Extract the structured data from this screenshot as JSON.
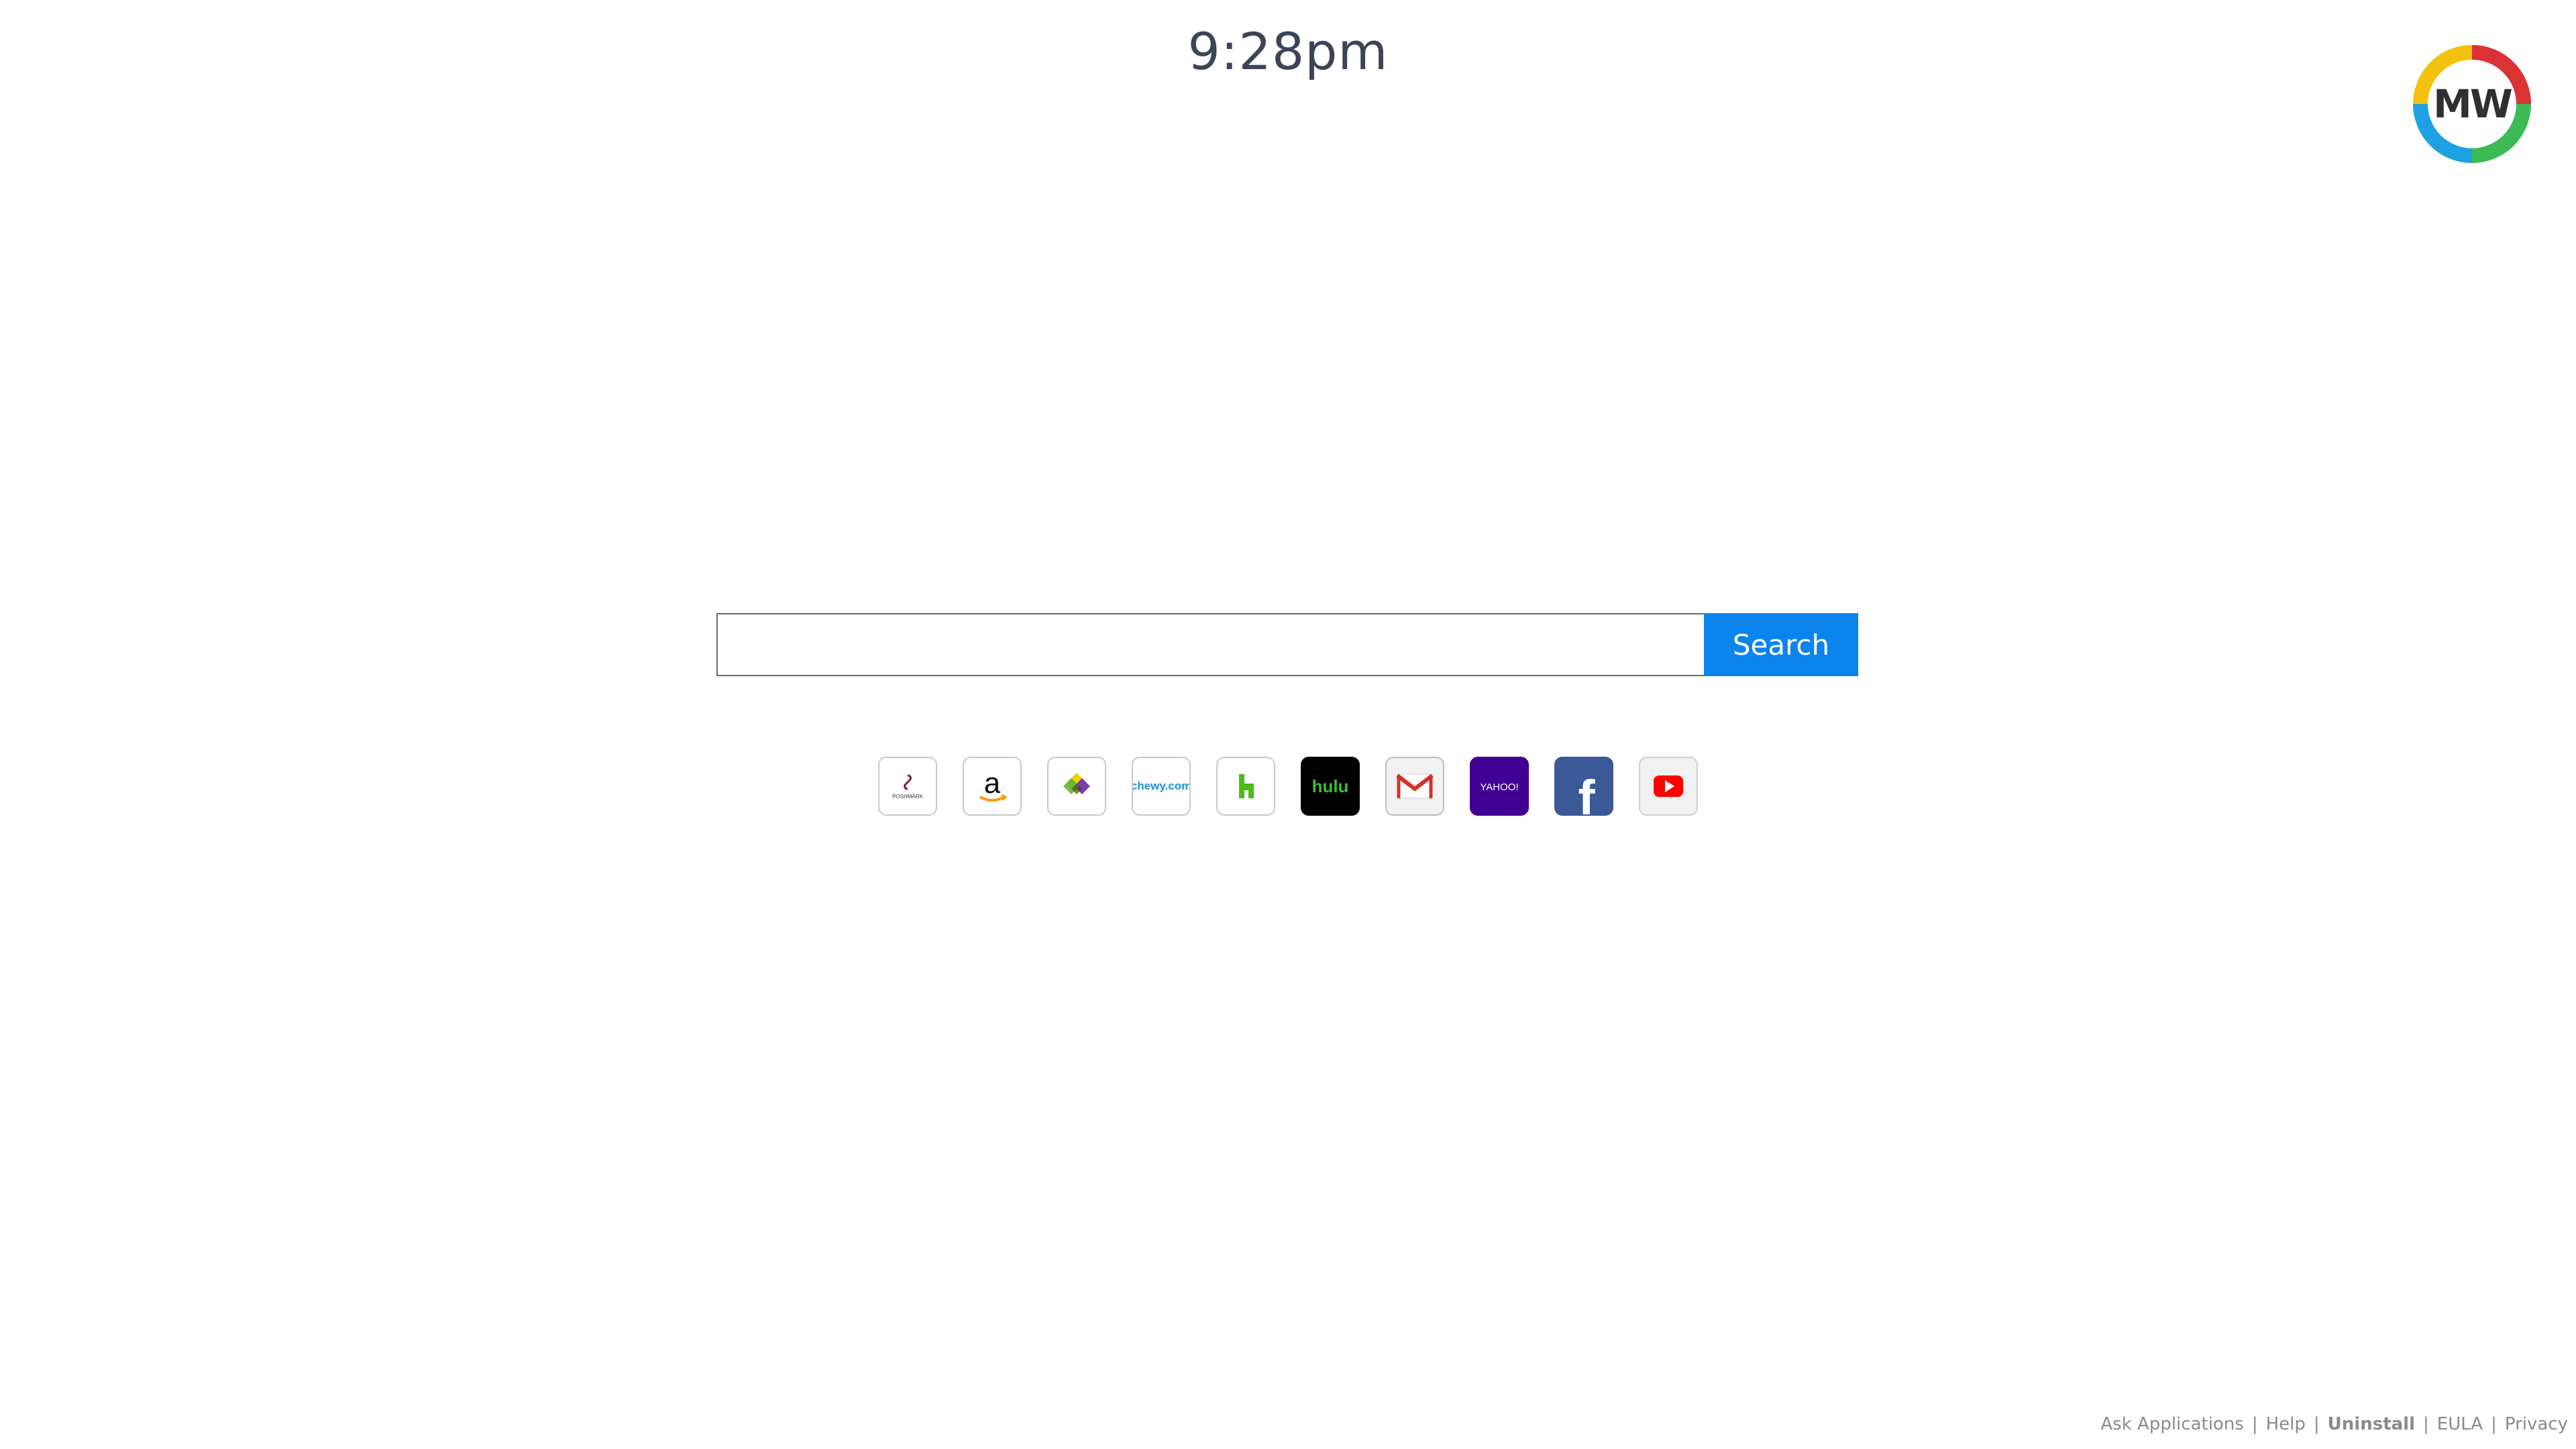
{
  "clock": {
    "time": "9:28pm"
  },
  "logo": {
    "text": "MW",
    "ring_colors": [
      "#db3236",
      "#3cba54",
      "#1da1e2",
      "#f4c20d"
    ]
  },
  "search": {
    "input_value": "",
    "placeholder": "",
    "button_label": "Search",
    "button_color": "#0b84ee"
  },
  "shortcuts": [
    {
      "name": "poshmark",
      "label": "POSHMARK",
      "icon": "poshmark-icon"
    },
    {
      "name": "amazon",
      "label": "a",
      "icon": "amazon-icon"
    },
    {
      "name": "jet",
      "label": "",
      "icon": "jet-icon"
    },
    {
      "name": "chewy",
      "label": "chewy.com",
      "icon": "chewy-icon"
    },
    {
      "name": "houzz",
      "label": "h",
      "icon": "houzz-icon"
    },
    {
      "name": "hulu",
      "label": "hulu",
      "icon": "hulu-icon"
    },
    {
      "name": "gmail",
      "label": "",
      "icon": "gmail-icon"
    },
    {
      "name": "yahoo",
      "label": "YAHOO!",
      "icon": "yahoo-icon"
    },
    {
      "name": "facebook",
      "label": "f",
      "icon": "facebook-icon"
    },
    {
      "name": "youtube",
      "label": "",
      "icon": "youtube-icon"
    }
  ],
  "footer": {
    "links": [
      {
        "label": "Ask Applications",
        "bold": false
      },
      {
        "label": "Help",
        "bold": false
      },
      {
        "label": "Uninstall",
        "bold": true
      },
      {
        "label": "EULA",
        "bold": false
      },
      {
        "label": "Privacy",
        "bold": false
      }
    ],
    "separator": "|"
  }
}
